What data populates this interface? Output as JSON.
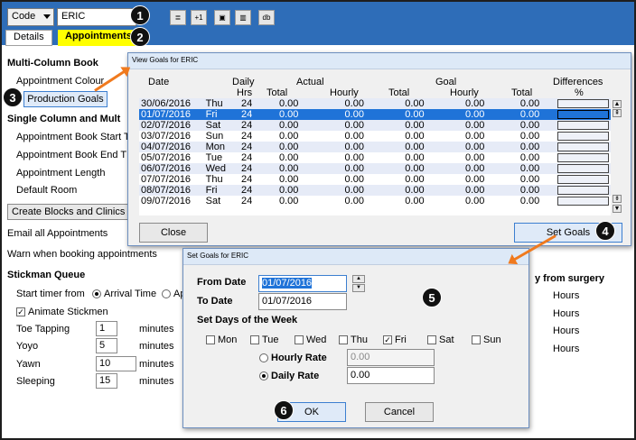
{
  "toolbar": {
    "combo_value": "Code",
    "patient_name": "ERIC",
    "buttons": [
      "≣",
      "+1",
      "▣",
      "▥",
      "db"
    ]
  },
  "tabs": [
    {
      "label": "Details"
    },
    {
      "label": "Appointments"
    }
  ],
  "callouts": [
    "1",
    "2",
    "3",
    "4",
    "5",
    "6"
  ],
  "left": {
    "multi_col_heading": "Multi-Column Book",
    "appointment_colour": "Appointment Colour",
    "production_goals_button": "Production Goals",
    "single_col_heading": "Single Column and Mult",
    "book_start": "Appointment Book Start T",
    "book_end": "Appointment Book End T",
    "appt_length": "Appointment Length",
    "default_room": "Default Room",
    "create_blocks_button": "Create Blocks and Clinics",
    "email_all": "Email all Appointments",
    "warn_booking": "Warn when booking appointments",
    "stickman_heading": "Stickman Queue",
    "start_timer_label": "Start timer from",
    "arrival_time": "Arrival Time",
    "ap_fragment": "Ap",
    "animate_stickmen": "Animate Stickmen",
    "stickmen_rows": [
      {
        "label": "Toe Tapping",
        "value": "1",
        "unit": "minutes"
      },
      {
        "label": "Yoyo",
        "value": "5",
        "unit": "minutes"
      },
      {
        "label": "Yawn",
        "value": "10",
        "unit": "minutes"
      },
      {
        "label": "Sleeping",
        "value": "15",
        "unit": "minutes"
      }
    ]
  },
  "right": {
    "heading": "y from surgery",
    "hours": [
      "Hours",
      "Hours",
      "Hours",
      "Hours"
    ]
  },
  "view_goals": {
    "title": "View Goals for ERIC",
    "header1": {
      "date": "Date",
      "daily": "Daily",
      "actual": "Actual",
      "goal": "Goal",
      "differences": "Differences"
    },
    "header2": {
      "hrs": "Hrs",
      "total": "Total",
      "hourly": "Hourly",
      "total2": "Total",
      "hourly2": "Hourly",
      "total3": "Total",
      "pct": "%"
    },
    "rows": [
      {
        "date": "30/06/2016",
        "day": "Thu",
        "hrs": "24",
        "a_total": "0.00",
        "a_hourly": "0.00",
        "g_total": "0.00",
        "g_hourly": "0.00",
        "total": "0.00"
      },
      {
        "date": "01/07/2016",
        "day": "Fri",
        "hrs": "24",
        "a_total": "0.00",
        "a_hourly": "0.00",
        "g_total": "0.00",
        "g_hourly": "0.00",
        "total": "0.00"
      },
      {
        "date": "02/07/2016",
        "day": "Sat",
        "hrs": "24",
        "a_total": "0.00",
        "a_hourly": "0.00",
        "g_total": "0.00",
        "g_hourly": "0.00",
        "total": "0.00"
      },
      {
        "date": "03/07/2016",
        "day": "Sun",
        "hrs": "24",
        "a_total": "0.00",
        "a_hourly": "0.00",
        "g_total": "0.00",
        "g_hourly": "0.00",
        "total": "0.00"
      },
      {
        "date": "04/07/2016",
        "day": "Mon",
        "hrs": "24",
        "a_total": "0.00",
        "a_hourly": "0.00",
        "g_total": "0.00",
        "g_hourly": "0.00",
        "total": "0.00"
      },
      {
        "date": "05/07/2016",
        "day": "Tue",
        "hrs": "24",
        "a_total": "0.00",
        "a_hourly": "0.00",
        "g_total": "0.00",
        "g_hourly": "0.00",
        "total": "0.00"
      },
      {
        "date": "06/07/2016",
        "day": "Wed",
        "hrs": "24",
        "a_total": "0.00",
        "a_hourly": "0.00",
        "g_total": "0.00",
        "g_hourly": "0.00",
        "total": "0.00"
      },
      {
        "date": "07/07/2016",
        "day": "Thu",
        "hrs": "24",
        "a_total": "0.00",
        "a_hourly": "0.00",
        "g_total": "0.00",
        "g_hourly": "0.00",
        "total": "0.00"
      },
      {
        "date": "08/07/2016",
        "day": "Fri",
        "hrs": "24",
        "a_total": "0.00",
        "a_hourly": "0.00",
        "g_total": "0.00",
        "g_hourly": "0.00",
        "total": "0.00"
      },
      {
        "date": "09/07/2016",
        "day": "Sat",
        "hrs": "24",
        "a_total": "0.00",
        "a_hourly": "0.00",
        "g_total": "0.00",
        "g_hourly": "0.00",
        "total": "0.00"
      }
    ],
    "close_button": "Close",
    "set_goals_button": "Set Goals"
  },
  "set_goals": {
    "title": "Set Goals for ERIC",
    "from_date_label": "From Date",
    "from_date_value": "01/07/2016",
    "to_date_label": "To Date",
    "to_date_value": "01/07/2016",
    "days_heading": "Set Days of the Week",
    "days": [
      {
        "label": "Mon",
        "checked": false
      },
      {
        "label": "Tue",
        "checked": false
      },
      {
        "label": "Wed",
        "checked": false
      },
      {
        "label": "Thu",
        "checked": false
      },
      {
        "label": "Fri",
        "checked": true
      },
      {
        "label": "Sat",
        "checked": false
      },
      {
        "label": "Sun",
        "checked": false
      }
    ],
    "hourly_rate_label": "Hourly Rate",
    "hourly_rate_value": "0.00",
    "daily_rate_label": "Daily Rate",
    "daily_rate_value": "0.00",
    "ok_button": "OK",
    "cancel_button": "Cancel"
  },
  "colors": {
    "topbar": "#2e6db8",
    "selection": "#1f73d8",
    "highlight": "#ffff00",
    "arrow": "#f07a1e"
  }
}
